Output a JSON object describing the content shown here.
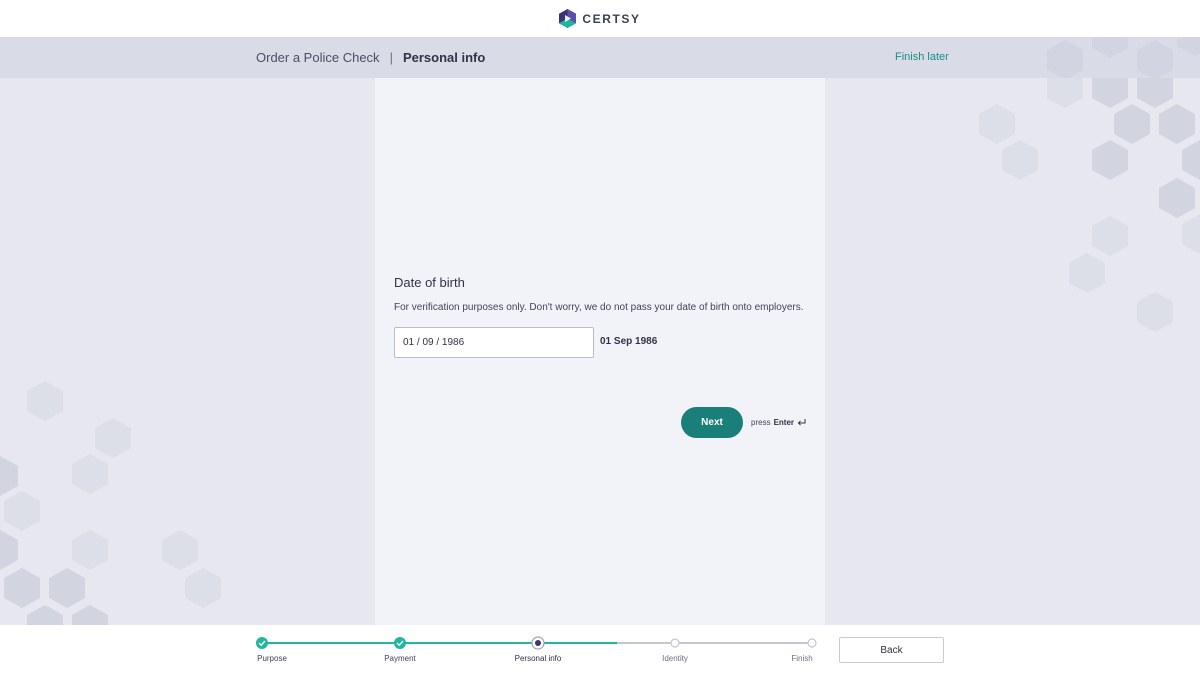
{
  "brand": {
    "name": "CERTSY"
  },
  "header": {
    "breadcrumb_root": "Order a Police Check",
    "breadcrumb_separator": "|",
    "breadcrumb_current": "Personal info",
    "finish_later": "Finish later"
  },
  "question": {
    "title": "Date of birth",
    "help": "For verification purposes only. Don't worry, we do not pass your date of birth onto employers.",
    "input_value": "01 / 09 / 1986",
    "formatted_value": "01 Sep 1986",
    "next_label": "Next",
    "hint_prefix": "press",
    "hint_key": "Enter"
  },
  "footer": {
    "back_label": "Back",
    "steps": [
      {
        "label": "Purpose",
        "status": "done"
      },
      {
        "label": "Payment",
        "status": "done"
      },
      {
        "label": "Personal info",
        "status": "current"
      },
      {
        "label": "Identity",
        "status": "pending"
      },
      {
        "label": "Finish",
        "status": "pending"
      }
    ]
  },
  "colors": {
    "accent": "#1b7f79",
    "step_done": "#22b5a0",
    "step_current": "#3b3470",
    "step_pending": "#c3c6d4"
  },
  "icons": {
    "logo": "hexagon-logo-icon",
    "step_done": "check-icon",
    "enter": "return-arrow-icon"
  }
}
